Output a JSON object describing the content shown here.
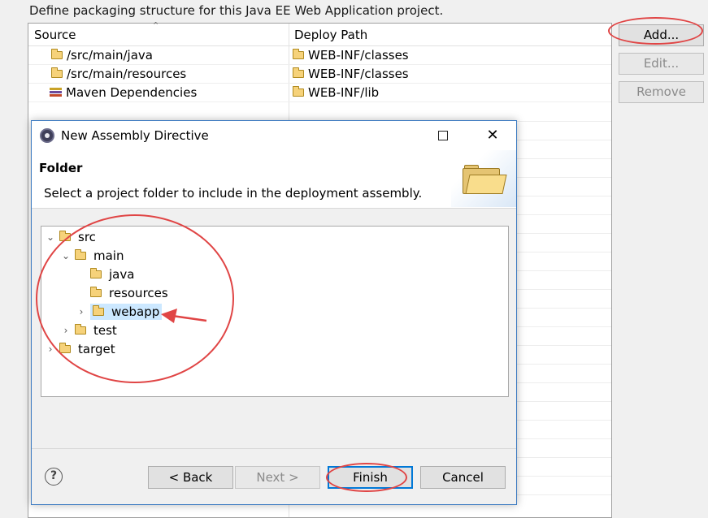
{
  "page": {
    "description": "Define packaging structure for this Java EE Web Application project."
  },
  "table": {
    "columns": [
      "Source",
      "Deploy Path"
    ],
    "rows": [
      {
        "source": "/src/main/java",
        "source_icon": "folder-icon",
        "deploy": "WEB-INF/classes"
      },
      {
        "source": "/src/main/resources",
        "source_icon": "folder-icon",
        "deploy": "WEB-INF/classes"
      },
      {
        "source": "Maven Dependencies",
        "source_icon": "maven-library-icon",
        "deploy": "WEB-INF/lib"
      }
    ]
  },
  "side_buttons": {
    "add": "Add...",
    "edit": "Edit...",
    "remove": "Remove"
  },
  "dialog": {
    "title": "New Assembly Directive",
    "heading": "Folder",
    "instruction": "Select a project folder to include in the deployment assembly.",
    "tree": [
      {
        "label": "src",
        "expanded": true,
        "level": 0
      },
      {
        "label": "main",
        "expanded": true,
        "level": 1
      },
      {
        "label": "java",
        "expanded": false,
        "level": 2
      },
      {
        "label": "resources",
        "expanded": false,
        "level": 2
      },
      {
        "label": "webapp",
        "expanded": false,
        "level": 2,
        "selected": true
      },
      {
        "label": "test",
        "expanded": false,
        "level": 1
      },
      {
        "label": "target",
        "expanded": false,
        "level": 0
      }
    ],
    "buttons": {
      "back": "< Back",
      "next": "Next >",
      "finish": "Finish",
      "cancel": "Cancel"
    }
  },
  "colors": {
    "annotation": "#e04545",
    "selection": "#cce8ff",
    "dialog_border": "#3e7cc2"
  }
}
